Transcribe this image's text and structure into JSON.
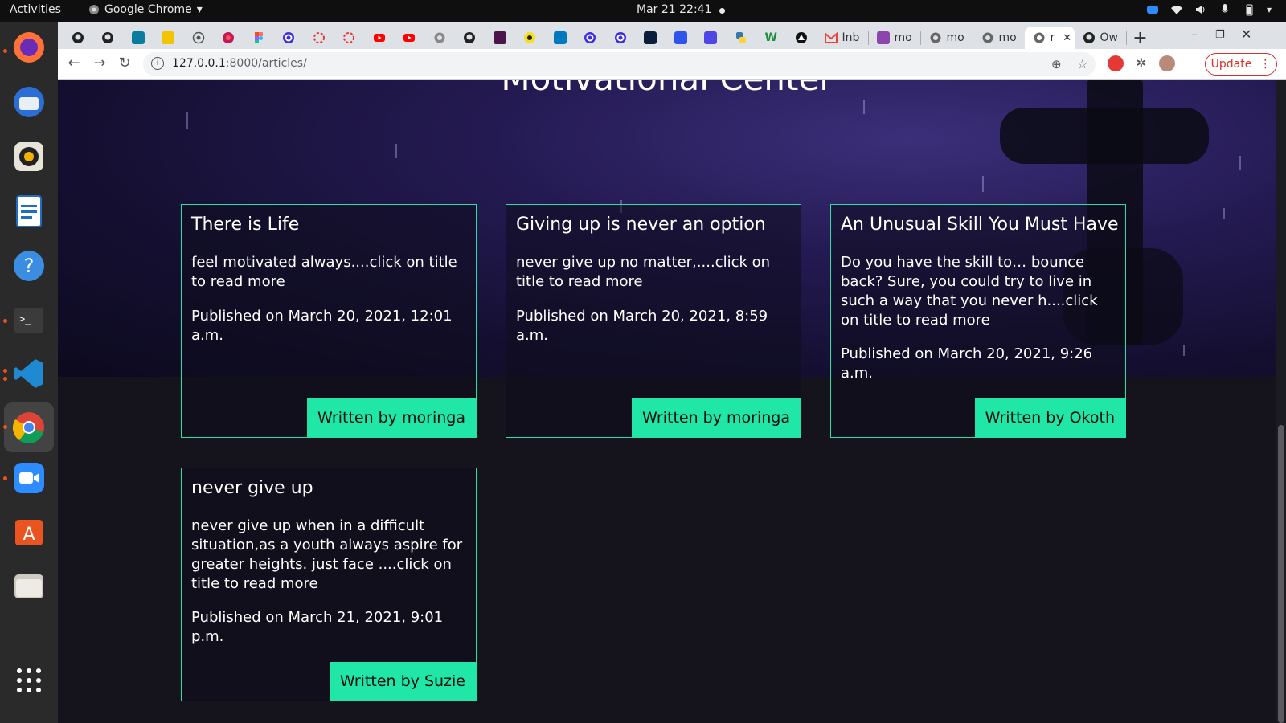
{
  "system": {
    "activities": "Activities",
    "app_name": "Google Chrome",
    "clock": "Mar 21  22:41"
  },
  "browser": {
    "tabs": [
      {
        "icon": "github-icon"
      },
      {
        "icon": "github-icon"
      },
      {
        "icon": "jira-icon"
      },
      {
        "icon": "shield-icon"
      },
      {
        "icon": "globe-icon"
      },
      {
        "icon": "circle-icon"
      },
      {
        "icon": "figma-icon"
      },
      {
        "icon": "c-icon"
      },
      {
        "icon": "loader-icon"
      },
      {
        "icon": "loader-icon"
      },
      {
        "icon": "youtube-icon"
      },
      {
        "icon": "youtube-icon"
      },
      {
        "icon": "globe-icon"
      },
      {
        "icon": "github-icon"
      },
      {
        "icon": "slack-icon"
      },
      {
        "icon": "coin-icon"
      },
      {
        "icon": "trello-icon"
      },
      {
        "icon": "c-icon"
      },
      {
        "icon": "c-icon"
      },
      {
        "icon": "terminal-icon"
      },
      {
        "icon": "layout-icon"
      },
      {
        "icon": "docs-icon"
      },
      {
        "icon": "python-icon"
      },
      {
        "icon": "w-icon"
      },
      {
        "icon": "triangle-icon"
      }
    ],
    "wide_tabs": [
      {
        "icon": "gmail-icon",
        "label": "Inb"
      },
      {
        "icon": "h-icon",
        "label": "mo"
      },
      {
        "icon": "globe-icon",
        "label": "mo"
      },
      {
        "icon": "globe-icon",
        "label": "mo"
      }
    ],
    "active_tab": {
      "icon": "globe-icon",
      "label": "r"
    },
    "last_tab": {
      "icon": "github-icon",
      "label": "Ow"
    },
    "url_host": "127.0.0.1",
    "url_path": ":8000/articles/",
    "update_label": "Update"
  },
  "page": {
    "title": "Motivational Center",
    "articles": [
      {
        "title": "There is Life",
        "description": "feel motivated always....click on title to read more",
        "published": "Published on March 20, 2021, 12:01 a.m.",
        "author": "Written by moringa"
      },
      {
        "title": "Giving up is never an option",
        "description": "never give up no matter,....click on title to read more",
        "published": "Published on March 20, 2021, 8:59 a.m.",
        "author": "Written by moringa"
      },
      {
        "title": "An Unusual Skill You Must Have",
        "description": "Do you have the skill to… bounce back? Sure, you could try to live in such a way that you never h....click on title to read more",
        "published": "Published on March 20, 2021, 9:26 a.m.",
        "author": "Written by Okoth"
      },
      {
        "title": "never give up",
        "description": "never give up when in a difficult situation,as a youth always aspire for greater heights. just face ....click on title to read more",
        "published": "Published on March 21, 2021, 9:01 p.m.",
        "author": "Written by Suzie"
      }
    ]
  },
  "colors": {
    "accent": "#20e6a6",
    "card_border": "#27e0a5",
    "background": "#15131c"
  }
}
